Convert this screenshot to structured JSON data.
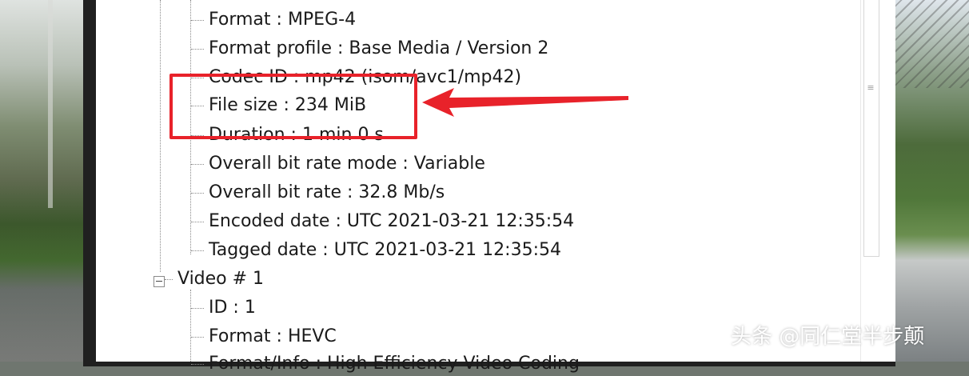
{
  "general": {
    "partial_label": "...",
    "items": [
      {
        "label": "Format",
        "value": "MPEG-4"
      },
      {
        "label": "Format profile",
        "value": "Base Media / Version 2"
      },
      {
        "label": "Codec ID",
        "value": "mp42 (isom/avc1/mp42)"
      },
      {
        "label": "File size",
        "value": "234 MiB"
      },
      {
        "label": "Duration",
        "value": "1 min 0 s"
      },
      {
        "label": "Overall bit rate mode",
        "value": "Variable"
      },
      {
        "label": "Overall bit rate",
        "value": "32.8 Mb/s"
      },
      {
        "label": "Encoded date",
        "value": "UTC 2021-03-21 12:35:54"
      },
      {
        "label": "Tagged date",
        "value": "UTC 2021-03-21 12:35:54"
      }
    ]
  },
  "video": {
    "section_label": "Video # 1",
    "items": [
      {
        "label": "ID",
        "value": "1"
      },
      {
        "label": "Format",
        "value": "HEVC"
      },
      {
        "label": "Format/Info",
        "value": "High Efficiency Video Coding"
      }
    ]
  },
  "annotation": {
    "highlight_color": "#e8222a",
    "arrow_color": "#e8222a"
  },
  "watermark": "头条 @同仁堂半步颠"
}
